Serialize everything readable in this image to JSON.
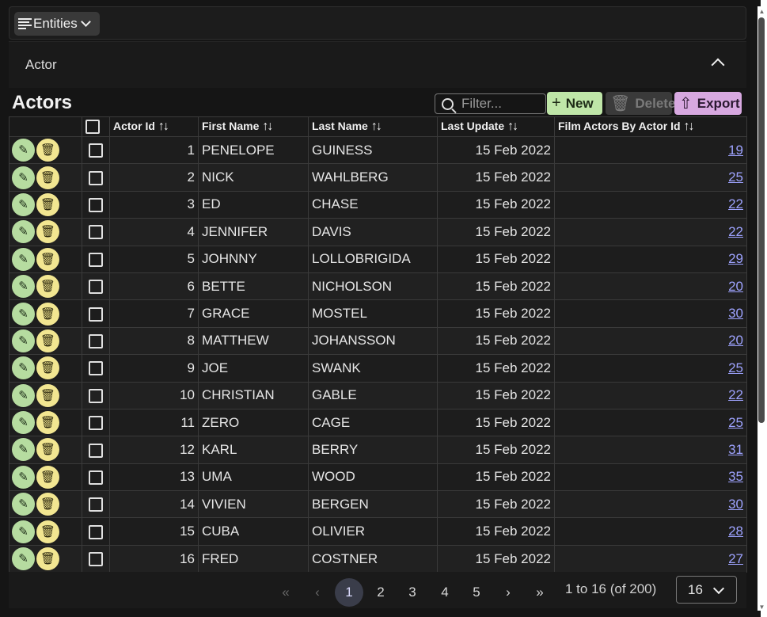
{
  "nav": {
    "entities_label": "Entities"
  },
  "panel": {
    "title": "Actor"
  },
  "grid": {
    "title": "Actors",
    "filter_placeholder": "Filter...",
    "new_label": "New",
    "delete_label": "Delete",
    "export_label": "Export",
    "columns": [
      "Actor Id",
      "First Name",
      "Last Name",
      "Last Update",
      "Film Actors By Actor Id"
    ],
    "sort_glyph": "↑↓",
    "rows": [
      {
        "id": "1",
        "first": "PENELOPE",
        "last": "GUINESS",
        "updated": "15 Feb 2022",
        "films": "19"
      },
      {
        "id": "2",
        "first": "NICK",
        "last": "WAHLBERG",
        "updated": "15 Feb 2022",
        "films": "25"
      },
      {
        "id": "3",
        "first": "ED",
        "last": "CHASE",
        "updated": "15 Feb 2022",
        "films": "22"
      },
      {
        "id": "4",
        "first": "JENNIFER",
        "last": "DAVIS",
        "updated": "15 Feb 2022",
        "films": "22"
      },
      {
        "id": "5",
        "first": "JOHNNY",
        "last": "LOLLOBRIGIDA",
        "updated": "15 Feb 2022",
        "films": "29"
      },
      {
        "id": "6",
        "first": "BETTE",
        "last": "NICHOLSON",
        "updated": "15 Feb 2022",
        "films": "20"
      },
      {
        "id": "7",
        "first": "GRACE",
        "last": "MOSTEL",
        "updated": "15 Feb 2022",
        "films": "30"
      },
      {
        "id": "8",
        "first": "MATTHEW",
        "last": "JOHANSSON",
        "updated": "15 Feb 2022",
        "films": "20"
      },
      {
        "id": "9",
        "first": "JOE",
        "last": "SWANK",
        "updated": "15 Feb 2022",
        "films": "25"
      },
      {
        "id": "10",
        "first": "CHRISTIAN",
        "last": "GABLE",
        "updated": "15 Feb 2022",
        "films": "22"
      },
      {
        "id": "11",
        "first": "ZERO",
        "last": "CAGE",
        "updated": "15 Feb 2022",
        "films": "25"
      },
      {
        "id": "12",
        "first": "KARL",
        "last": "BERRY",
        "updated": "15 Feb 2022",
        "films": "31"
      },
      {
        "id": "13",
        "first": "UMA",
        "last": "WOOD",
        "updated": "15 Feb 2022",
        "films": "35"
      },
      {
        "id": "14",
        "first": "VIVIEN",
        "last": "BERGEN",
        "updated": "15 Feb 2022",
        "films": "30"
      },
      {
        "id": "15",
        "first": "CUBA",
        "last": "OLIVIER",
        "updated": "15 Feb 2022",
        "films": "28"
      },
      {
        "id": "16",
        "first": "FRED",
        "last": "COSTNER",
        "updated": "15 Feb 2022",
        "films": "27"
      }
    ]
  },
  "pager": {
    "first": "«",
    "prev": "‹",
    "pages": [
      "1",
      "2",
      "3",
      "4",
      "5"
    ],
    "active_page": "1",
    "next": "›",
    "last": "»",
    "range_text": "1 to 16 (of 200)",
    "page_size": "16"
  },
  "icons": {
    "menu": "menu-lines-icon",
    "search": "search-icon",
    "add": "plus-icon",
    "delete": "trash-icon",
    "export": "upload-icon",
    "edit": "pencil-icon"
  },
  "colors": {
    "new_button": "#bfe6a8",
    "export_button": "#d7a8e0",
    "edit_action": "#b6dca0",
    "delete_action": "#f2e691",
    "link": "#9ea3ff"
  }
}
